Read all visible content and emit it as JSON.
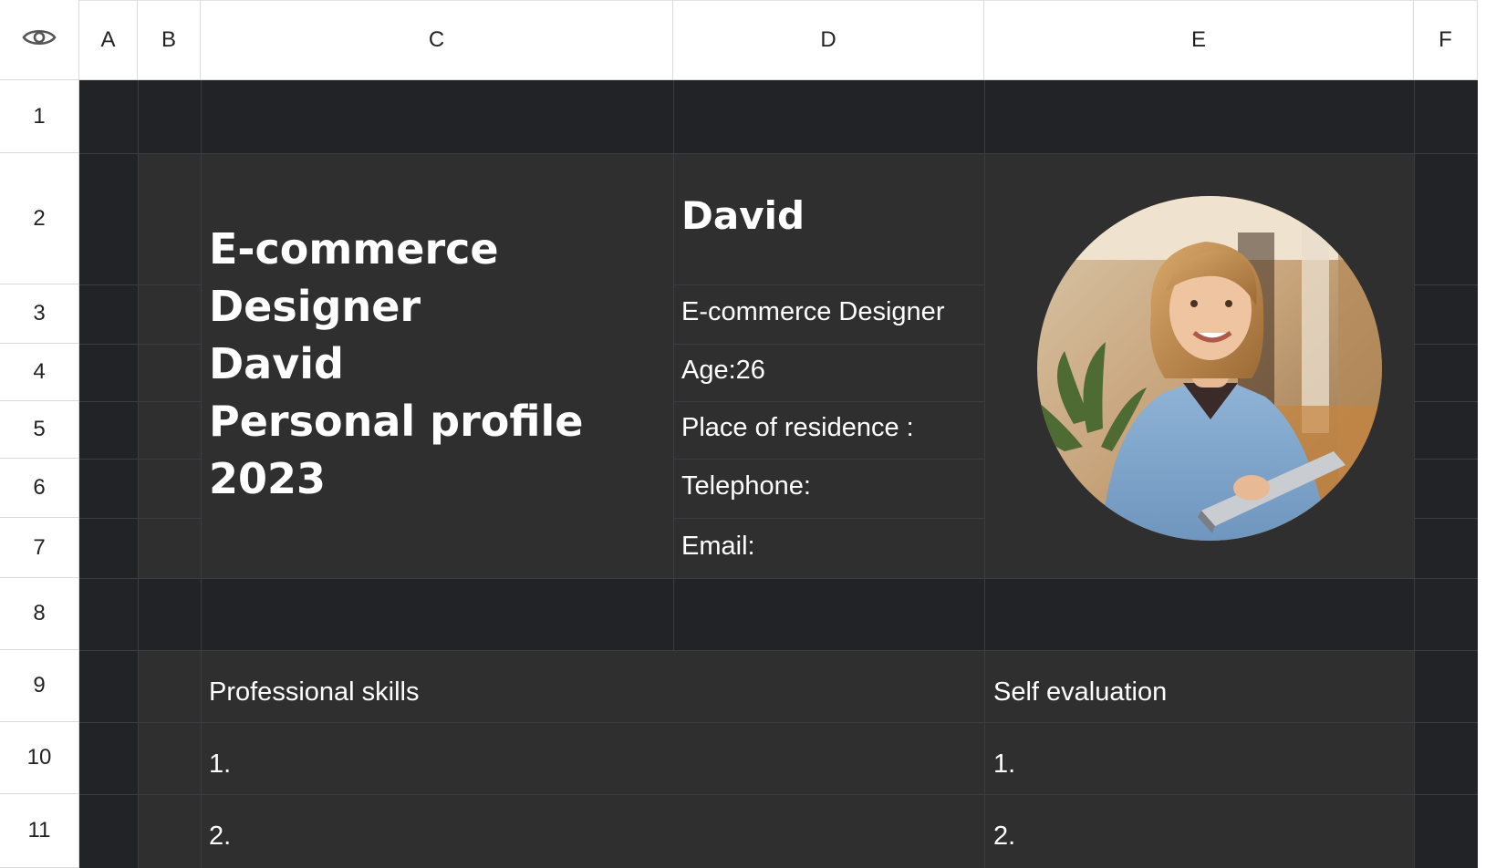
{
  "header": {
    "visibility_icon": "eye-icon",
    "columns": [
      "A",
      "B",
      "C",
      "D",
      "E",
      "F"
    ],
    "rows": [
      "1",
      "2",
      "3",
      "4",
      "5",
      "6",
      "7",
      "8",
      "9",
      "10",
      "11"
    ]
  },
  "profile": {
    "title_lines": [
      "E-commerce",
      "Designer",
      "David",
      "Personal profile",
      "2023"
    ],
    "name": "David",
    "role": "E-commerce Designer",
    "age": "Age:26",
    "residence": "Place of residence :",
    "telephone": "Telephone:",
    "email": "Email:",
    "photo": "profile-photo-woman-holding-laptop"
  },
  "skills": {
    "left_header": "Professional skills",
    "right_header": "Self evaluation",
    "left_items": [
      "1.",
      "2."
    ],
    "right_items": [
      "1.",
      "2."
    ]
  },
  "colors": {
    "sheet_dark": "#212326",
    "panel": "#2f2f2f",
    "text": "#ffffff"
  }
}
